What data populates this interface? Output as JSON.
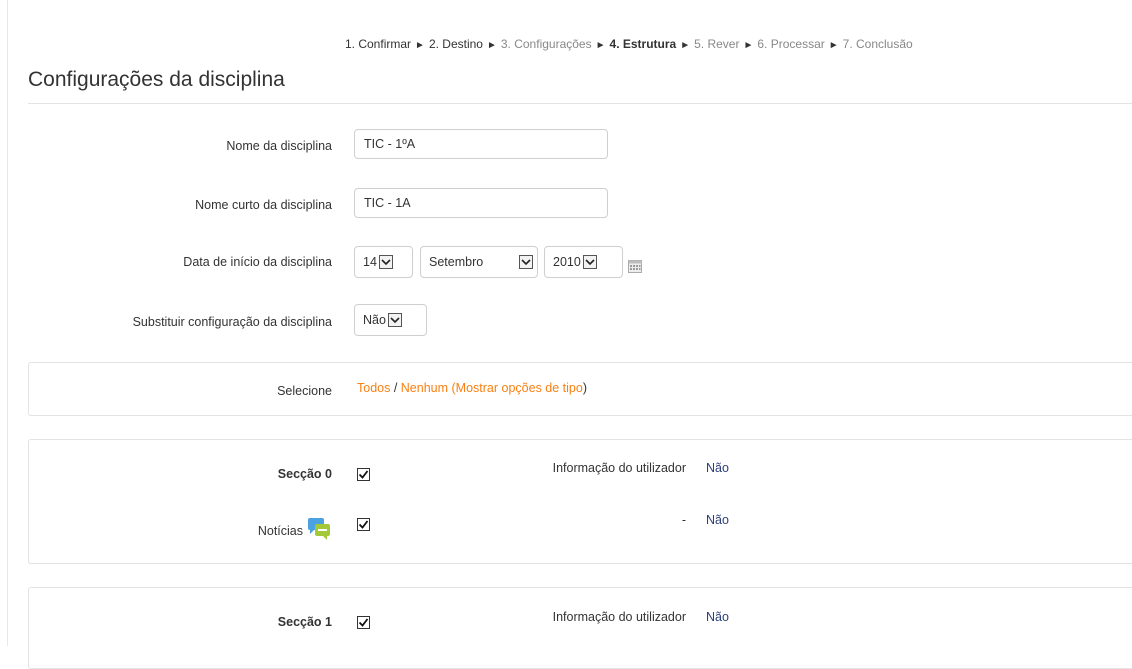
{
  "breadcrumb": {
    "steps": [
      {
        "label": "1. Confirmar",
        "state": "done"
      },
      {
        "label": "2. Destino",
        "state": "done"
      },
      {
        "label": "3. Configurações",
        "state": "muted"
      },
      {
        "label": "4. Estrutura",
        "state": "current"
      },
      {
        "label": "5. Rever",
        "state": "muted"
      },
      {
        "label": "6. Processar",
        "state": "muted"
      },
      {
        "label": "7. Conclusão",
        "state": "muted"
      }
    ],
    "separator": "►"
  },
  "page_title": "Configurações da disciplina",
  "form": {
    "course_name": {
      "label": "Nome da disciplina",
      "value": "TIC - 1ºA"
    },
    "course_shortname": {
      "label": "Nome curto da disciplina",
      "value": "TIC - 1A"
    },
    "start_date": {
      "label": "Data de início da disciplina",
      "day": "14",
      "month": "Setembro",
      "year": "2010"
    },
    "override": {
      "label": "Substituir configuração da disciplina",
      "value": "Não"
    }
  },
  "select_panel": {
    "label": "Selecione",
    "all": "Todos",
    "slash": " / ",
    "none": "Nenhum",
    "open_paren": " (",
    "show_types": "Mostrar opções de tipo",
    "close_paren": ")"
  },
  "sections": [
    {
      "title": "Secção 0",
      "checked": true,
      "info_label": "Informação do utilizador",
      "info_value": "Não",
      "activities": [
        {
          "name": "Notícias",
          "icon": "forum-icon",
          "checked": true,
          "info_label": "-",
          "info_value": "Não"
        }
      ]
    },
    {
      "title": "Secção 1",
      "checked": true,
      "info_label": "Informação do utilizador",
      "info_value": "Não",
      "activities": []
    }
  ],
  "colors": {
    "link": "#f98012",
    "value_text": "#2c3e7a",
    "border": "#e3e3e3"
  }
}
